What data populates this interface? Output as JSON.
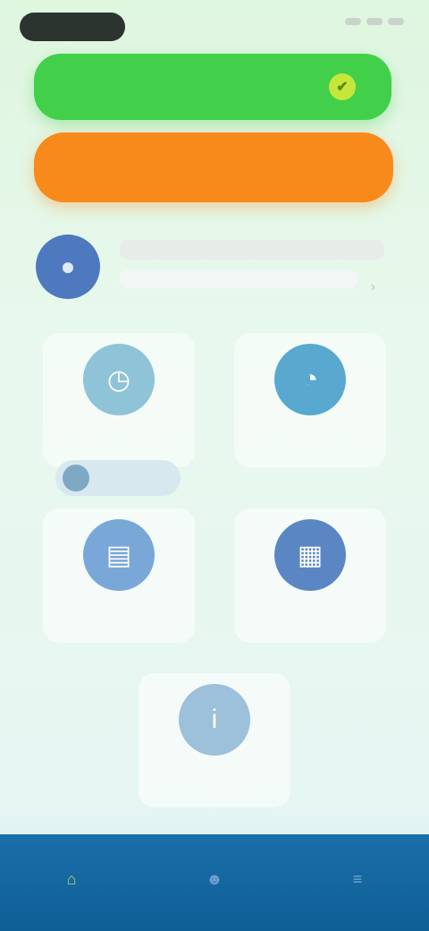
{
  "status_bar": {
    "time": "",
    "icons": [
      "signal-icon",
      "wifi-icon",
      "battery-icon"
    ]
  },
  "actions": {
    "primary": {
      "label": "",
      "color": "#42cf4a"
    },
    "secondary": {
      "label": "",
      "color": "#f88a1c"
    }
  },
  "profile": {
    "name": "",
    "subtitle": ""
  },
  "tiles": [
    {
      "label": "",
      "icon": "clock-icon",
      "color": "#8fc3d8"
    },
    {
      "label": "",
      "icon": "chart-pie-icon",
      "color": "#58a8cf"
    },
    {
      "label": "",
      "icon": "book-icon",
      "color": "#79a7d8"
    },
    {
      "label": "",
      "icon": "calendar-icon",
      "color": "#5a86c4"
    },
    {
      "label": "",
      "icon": "info-icon",
      "color": "#9dc0db"
    }
  ],
  "chip": {
    "label": ""
  },
  "bottom_nav": [
    {
      "label": "",
      "icon": "home-icon",
      "color": "#b7d96a"
    },
    {
      "label": "",
      "icon": "people-icon",
      "color": "#6f9ed0"
    },
    {
      "label": "",
      "icon": "menu-icon",
      "color": "#7aa8d0"
    }
  ],
  "theme": {
    "nav_bg": "#1a6fa8",
    "avatar": "#4e79be"
  }
}
